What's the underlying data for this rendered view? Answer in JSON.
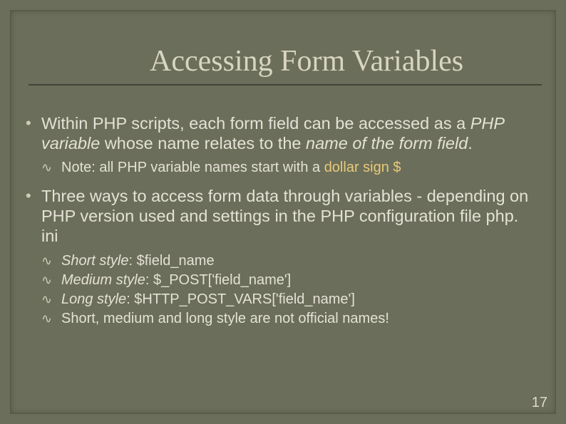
{
  "title": "Accessing Form Variables",
  "bullet1": {
    "pre": "Within PHP scripts, each form field can be accessed as a ",
    "em1": "PHP variable",
    "mid": " whose name relates to the ",
    "em2": "name of the form field",
    "post": "."
  },
  "note_line": {
    "lead": "Note: all PHP variable names start with a ",
    "hl": "dollar sign $"
  },
  "bullet2": "Three ways to access form data through variables - depending on PHP version used and settings in the PHP configuration file php. ini",
  "styles": {
    "short": {
      "label": "Short",
      "mid": " style",
      "code": ": $field_name"
    },
    "medium": {
      "label": "Medium",
      "mid": " style",
      "code": ": $_POST['field_name']"
    },
    "long": {
      "label": "Long",
      "mid": " style",
      "code": ": $HTTP_POST_VARS['field_name']"
    },
    "note": "Short, medium and long style are not official names!"
  },
  "page_number": "17"
}
